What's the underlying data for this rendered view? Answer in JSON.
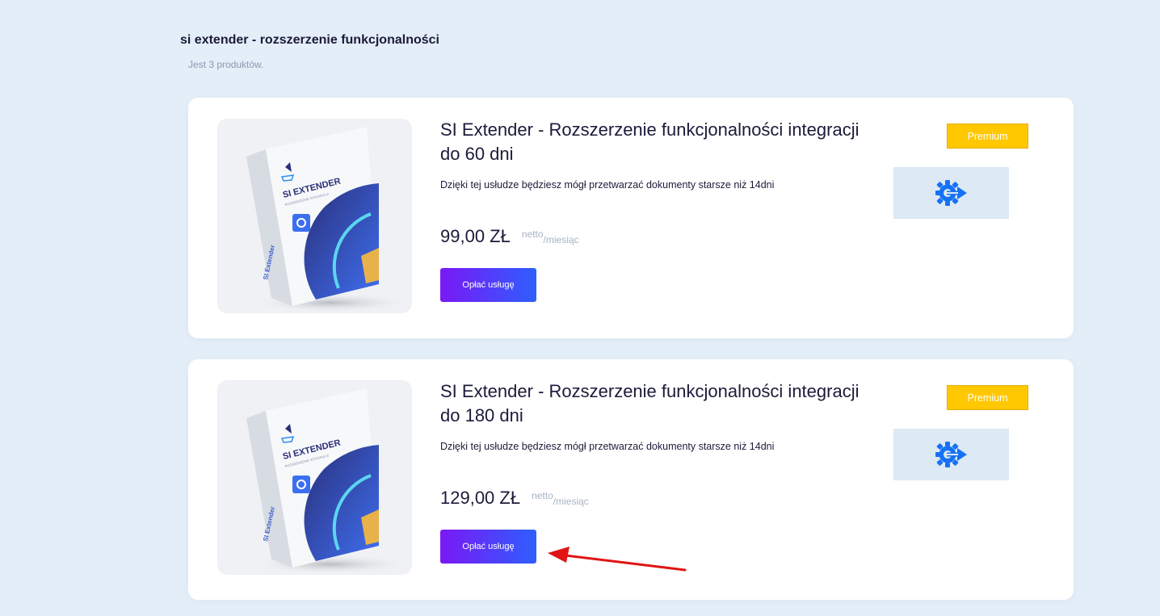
{
  "category": {
    "title": "si extender - rozszerzenie funkcjonalności",
    "count_text": "Jest 3 produktów."
  },
  "products": [
    {
      "title": "SI Extender - Rozszerzenie funkcjonalności integracji do 60 dni",
      "description": "Dzięki tej usłudze będziesz mógł przetwarzać dokumenty starsze niż 14dni",
      "price": "99,00 ZŁ",
      "netto": "netto",
      "period": "/miesiąc",
      "button_label": "Opłać usługę",
      "badge": "Premium",
      "image_icon": "gear-arrow-icon",
      "box_text": "SI EXTENDER",
      "box_subtext": "ROZSZERZENIE INTEGRACJI",
      "box_side_text": "SI Extender"
    },
    {
      "title": "SI Extender - Rozszerzenie funkcjonalności integracji do 180 dni",
      "description": "Dzięki tej usłudze będziesz mógł przetwarzać dokumenty starsze niż 14dni",
      "price": "129,00 ZŁ",
      "netto": "netto",
      "period": "/miesiąc",
      "button_label": "Opłać usługę",
      "badge": "Premium",
      "image_icon": "gear-arrow-icon",
      "box_text": "SI EXTENDER",
      "box_subtext": "ROZSZERZENIE INTEGRACJI",
      "box_side_text": "SI Extender"
    }
  ],
  "colors": {
    "background": "#e4eef8",
    "badge": "#ffc800",
    "button_start": "#7a18f5",
    "button_end": "#2e5fff",
    "icon_blue": "#1671f5",
    "annotation_arrow": "#e01414"
  }
}
